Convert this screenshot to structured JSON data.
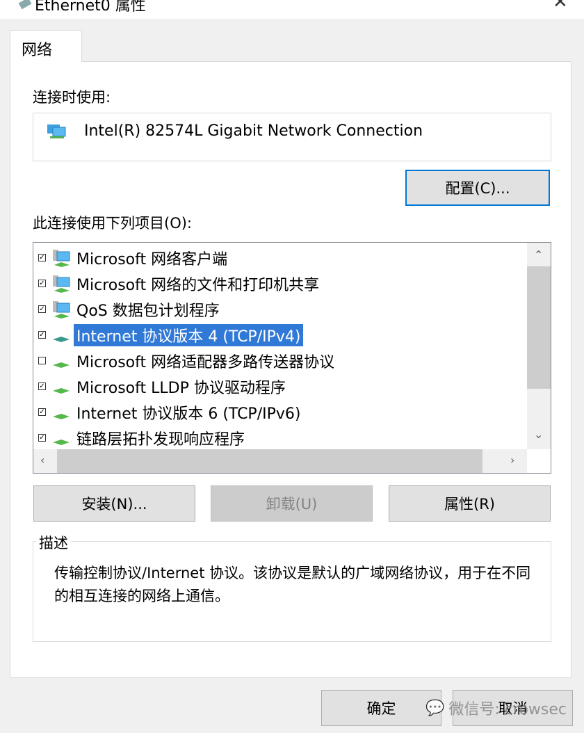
{
  "window": {
    "title": "Ethernet0 属性"
  },
  "tabs": [
    {
      "label": "网络"
    }
  ],
  "connect_using": {
    "label": "连接时使用:",
    "adapter": "Intel(R) 82574L Gigabit Network Connection",
    "configure_button": "配置(C)..."
  },
  "items_label": "此连接使用下列项目(O):",
  "items": [
    {
      "label": "Microsoft 网络客户端",
      "checked": true,
      "icon": "network-client-icon"
    },
    {
      "label": "Microsoft 网络的文件和打印机共享",
      "checked": true,
      "icon": "network-service-icon"
    },
    {
      "label": "QoS 数据包计划程序",
      "checked": true,
      "icon": "network-service-icon"
    },
    {
      "label": "Internet 协议版本 4 (TCP/IPv4)",
      "checked": true,
      "selected": true,
      "icon": "protocol-icon"
    },
    {
      "label": "Microsoft 网络适配器多路传送器协议",
      "checked": false,
      "icon": "protocol-icon"
    },
    {
      "label": "Microsoft LLDP 协议驱动程序",
      "checked": true,
      "icon": "protocol-icon"
    },
    {
      "label": "Internet 协议版本 6 (TCP/IPv6)",
      "checked": true,
      "icon": "protocol-icon"
    },
    {
      "label": "链路层拓扑发现响应程序",
      "checked": true,
      "icon": "protocol-icon"
    }
  ],
  "buttons": {
    "install": "安装(N)...",
    "uninstall": "卸载(U)",
    "properties": "属性(R)",
    "ok": "确定",
    "cancel": "取消"
  },
  "description": {
    "label": "描述",
    "text": "传输控制协议/Internet 协议。该协议是默认的广域网络协议，用于在不同的相互连接的网络上通信。"
  },
  "watermark": "微信号: crowsec",
  "colors": {
    "selection": "#3079d6",
    "focus": "#0078d7"
  }
}
